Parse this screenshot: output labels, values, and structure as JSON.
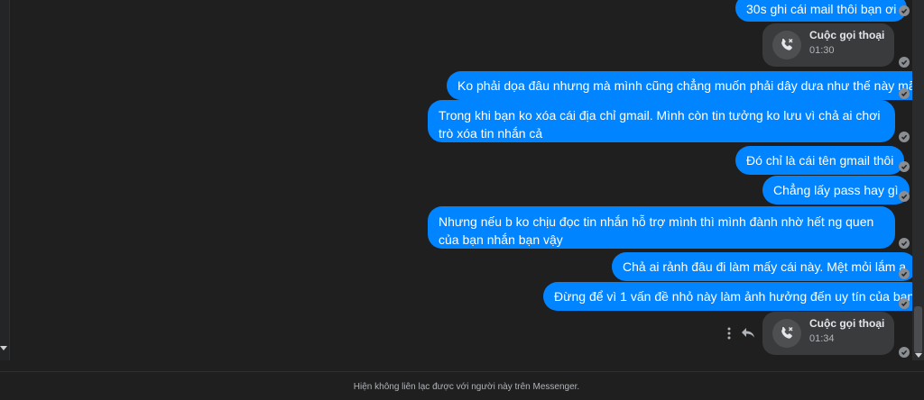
{
  "messages": [
    {
      "type": "text",
      "text": "30s ghi cái mail thôi bạn ơi"
    },
    {
      "type": "call",
      "title": "Cuộc gọi thoại",
      "duration": "01:30"
    },
    {
      "type": "text",
      "text": "Ko phải dọa đâu nhưng mà mình cũng chẳng muốn phải dây dưa như thế này mãi"
    },
    {
      "type": "text",
      "text": "Trong khi bạn ko xóa cái địa chỉ gmail. Mình còn tin tưởng ko lưu vì chả ai chơi trò xóa tin nhắn cả"
    },
    {
      "type": "text",
      "text": "Đó chỉ là cái tên gmail thôi"
    },
    {
      "type": "text",
      "text": "Chẳng lấy pass hay gì"
    },
    {
      "type": "text",
      "text": "Nhưng nếu b ko chịu đọc tin nhắn hỗ trợ mình thì mình đành nhờ hết ng quen của bạn nhắn bạn vậy"
    },
    {
      "type": "text",
      "text": "Chả ai rảnh đâu đi làm mấy cái này. Mệt mỏi lắm ạ"
    },
    {
      "type": "text",
      "text": "Đừng để vì 1 vấn đề nhỏ này làm ảnh hưởng đến uy tín của bạn"
    },
    {
      "type": "call",
      "title": "Cuộc gọi thoại",
      "duration": "01:34"
    }
  ],
  "footer": {
    "notice": "Hiện không liên lạc được với người này trên Messenger."
  },
  "colors": {
    "bubble": "#0084ff",
    "call_bg": "#3a3b3c",
    "background": "#1f1f20"
  },
  "icons": [
    "phone-missed-icon",
    "seen-check-icon",
    "more-options-icon",
    "reply-icon"
  ]
}
